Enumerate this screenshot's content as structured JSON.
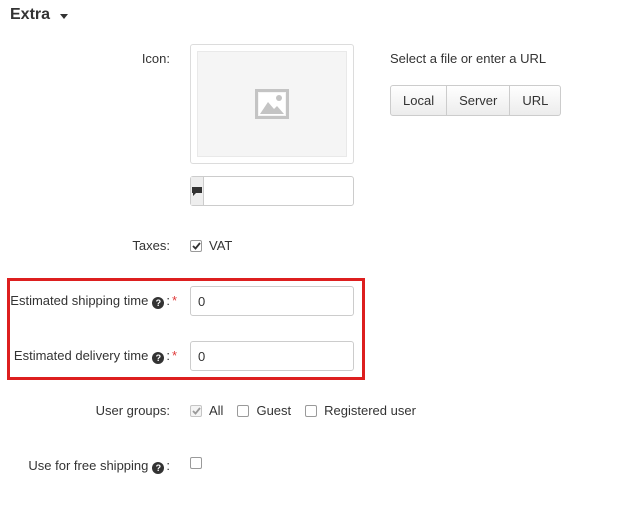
{
  "section": {
    "title": "Extra"
  },
  "icon": {
    "label": "Icon:",
    "select_text": "Select a file or enter a URL",
    "buttons": [
      {
        "label": "Local"
      },
      {
        "label": "Server"
      },
      {
        "label": "URL"
      }
    ],
    "alt_value": ""
  },
  "taxes": {
    "label": "Taxes:",
    "option": {
      "label": "VAT",
      "checked": true
    }
  },
  "shipping_time": {
    "label": "Estimated shipping time",
    "value": "0",
    "required_mark": "*",
    "colon": ":"
  },
  "delivery_time": {
    "label": "Estimated delivery time",
    "value": "0",
    "required_mark": "*",
    "colon": ":"
  },
  "user_groups": {
    "label": "User groups:",
    "options": [
      {
        "label": "All",
        "checked": true,
        "disabled": true
      },
      {
        "label": "Guest",
        "checked": false
      },
      {
        "label": "Registered user",
        "checked": false
      }
    ]
  },
  "free_shipping": {
    "label": "Use for free shipping",
    "colon": ":",
    "checked": false
  },
  "colors": {
    "highlight": "#dd1f1f",
    "required": "#e03a3a"
  }
}
